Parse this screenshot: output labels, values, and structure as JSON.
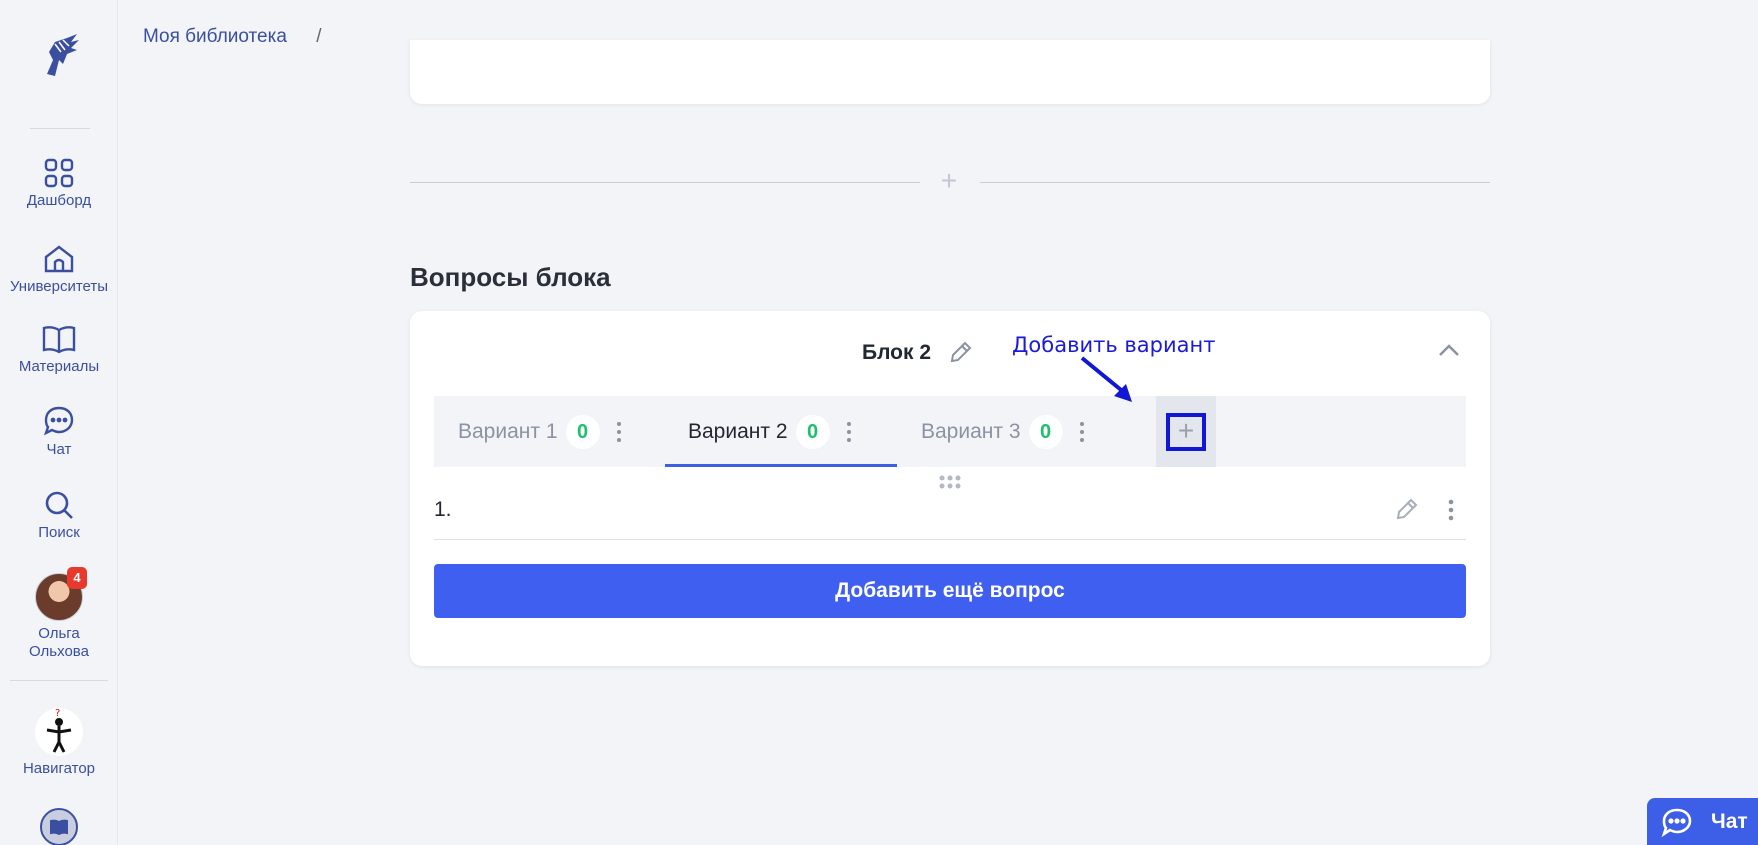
{
  "breadcrumb": {
    "root": "Моя библиотека",
    "separator": "/"
  },
  "sidebar": {
    "items": [
      {
        "label": "Дашборд",
        "icon": "dashboard-icon"
      },
      {
        "label": "Университеты",
        "icon": "university-icon"
      },
      {
        "label": "Материалы",
        "icon": "book-icon"
      },
      {
        "label": "Чат",
        "icon": "chat-icon"
      },
      {
        "label": "Поиск",
        "icon": "search-icon"
      }
    ],
    "user": {
      "first_name": "Ольга",
      "last_name": "Ольхова",
      "badge": "4"
    },
    "navigator": {
      "label": "Навигатор",
      "icon": "navigator-icon"
    }
  },
  "section": {
    "title": "Вопросы блока"
  },
  "block": {
    "title": "Блок 2",
    "tabs": [
      {
        "label": "Вариант 1",
        "count": "0",
        "active": false
      },
      {
        "label": "Вариант 2",
        "count": "0",
        "active": true
      },
      {
        "label": "Вариант 3",
        "count": "0",
        "active": false
      }
    ],
    "add_tab_symbol": "+",
    "question_number": "1.",
    "add_question_label": "Добавить ещё вопрос"
  },
  "annotation": {
    "text": "Добавить вариант",
    "color": "#1a1ad8"
  },
  "chat_button": {
    "label": "Чат"
  },
  "colors": {
    "accent": "#3d5ee6",
    "count_green": "#1fbf6e",
    "nav_blue": "#3b4fa0"
  }
}
